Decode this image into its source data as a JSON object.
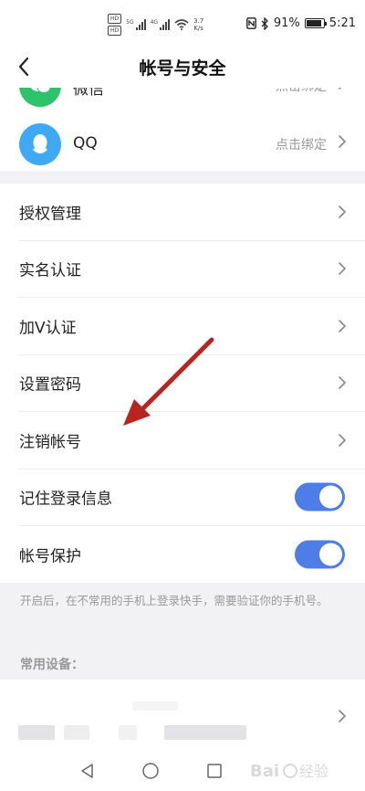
{
  "status_bar": {
    "network_speed_value": "3.7",
    "network_speed_unit": "K/s",
    "network_tag_1": "5G",
    "network_tag_2": "4G",
    "hd_badge": "HD",
    "battery": "91%",
    "battery_level": 0.91,
    "time": "5:21"
  },
  "header": {
    "title": "帐号与安全"
  },
  "third_party": [
    {
      "name": "微信",
      "action": "点击绑定",
      "color": "#2dc36a",
      "icon": "wechat-icon"
    },
    {
      "name": "QQ",
      "action": "点击绑定",
      "color": "#3fa9f5",
      "icon": "qq-icon"
    }
  ],
  "settings": {
    "items": [
      {
        "label": "授权管理",
        "type": "link"
      },
      {
        "label": "实名认证",
        "type": "link"
      },
      {
        "label": "加V认证",
        "type": "link"
      },
      {
        "label": "设置密码",
        "type": "link"
      },
      {
        "label": "注销帐号",
        "type": "link"
      },
      {
        "label": "记住登录信息",
        "type": "toggle",
        "on": true
      },
      {
        "label": "帐号保护",
        "type": "toggle",
        "on": true
      }
    ]
  },
  "hint": "开启后，在不常用的手机上登录快手，需要验证你的手机号。",
  "devices": {
    "title": "常用设备："
  },
  "colors": {
    "accent": "#4d7ee8",
    "annotation_arrow": "#b8241e"
  },
  "watermark": "Baidu经验"
}
